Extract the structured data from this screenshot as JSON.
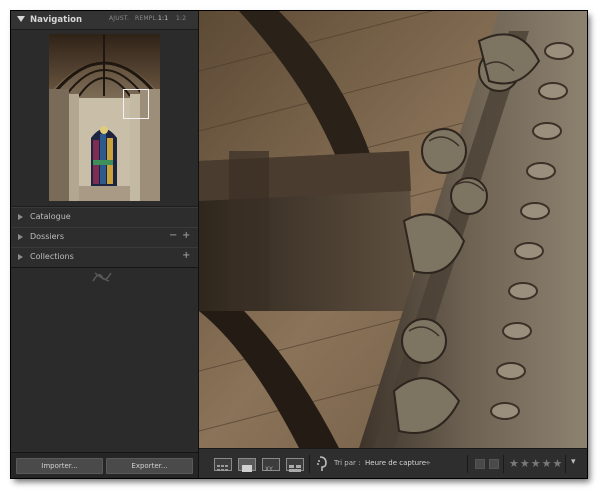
{
  "navigator": {
    "title": "Navigation",
    "zoom_options": [
      "AJUST.",
      "REMPL.",
      "1:1",
      "1:2"
    ]
  },
  "panels": [
    {
      "label": "Catalogue",
      "controls": []
    },
    {
      "label": "Dossiers",
      "controls": [
        "−",
        "+"
      ]
    },
    {
      "label": "Collections",
      "controls": [
        "+"
      ]
    }
  ],
  "buttons": {
    "import": "Importer...",
    "export": "Exporter..."
  },
  "toolbar": {
    "sort_label": "Tri par :",
    "sort_value": "Heure de capture",
    "sort_arrow": "÷",
    "stars": "★★★★★",
    "menu_arrow": "▾"
  },
  "colors": {
    "window_bg": "#2a2a2a",
    "panel_bg": "#2b2b2b",
    "text": "#cfcfcf",
    "stone": "#6f6454"
  }
}
